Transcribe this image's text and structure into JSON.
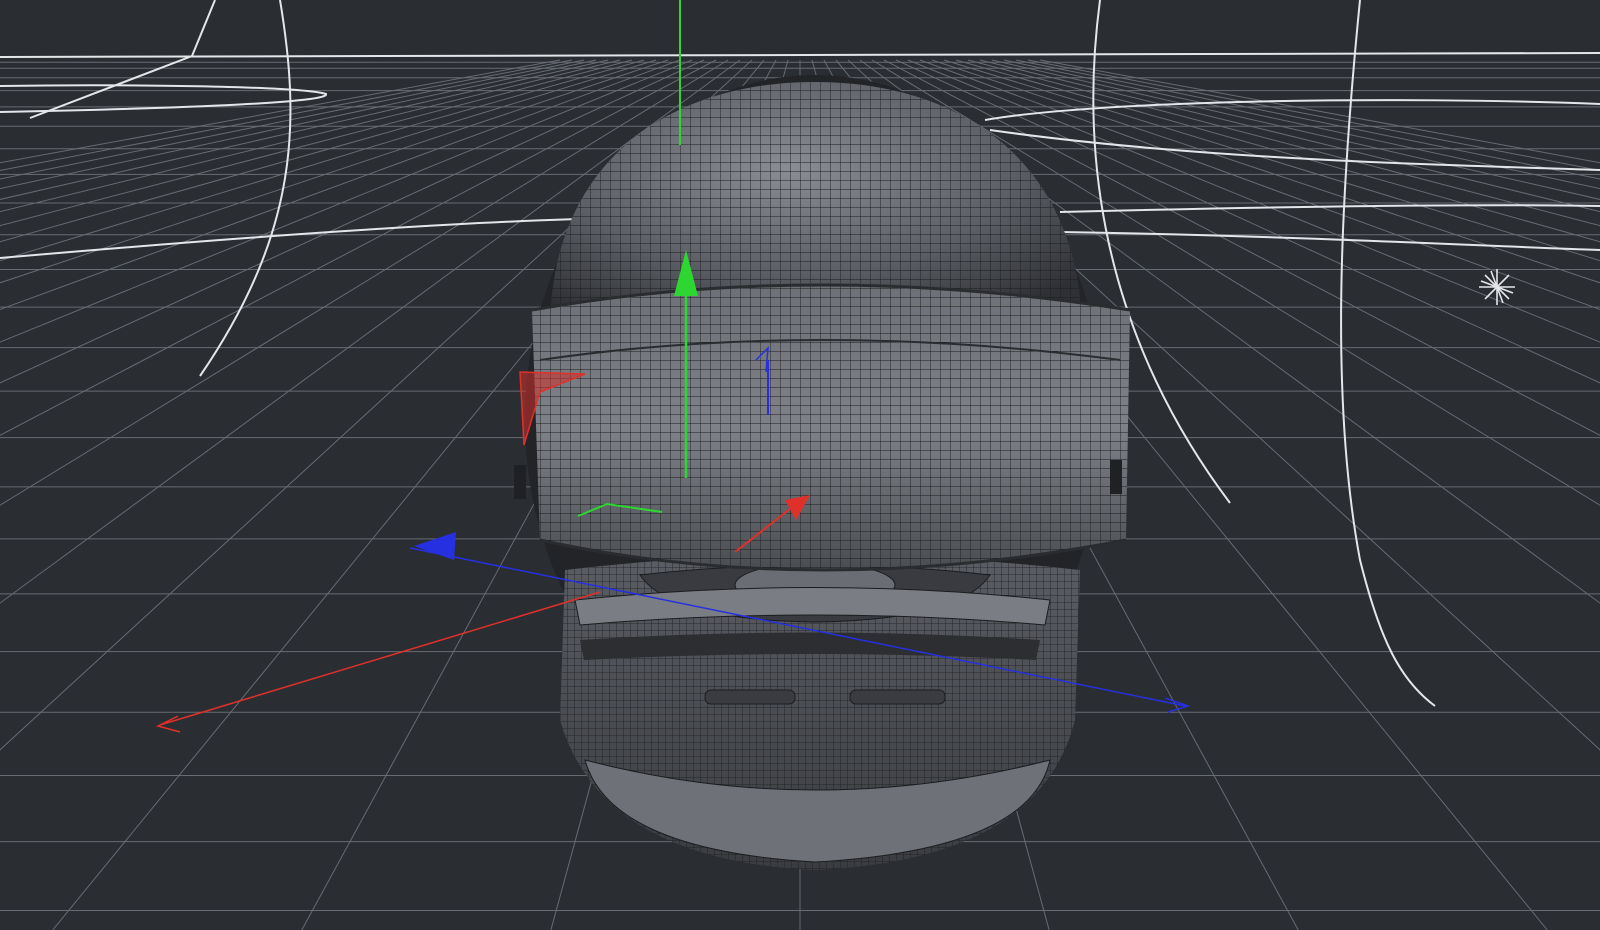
{
  "viewport": {
    "background": "#2a2d32",
    "grid_color": "#7c8088",
    "curve_color": "#e4e6ea"
  },
  "model": {
    "object": "helmet-mesh",
    "display_mode": "wireframe-on-shaded",
    "shell_color": "#55585e",
    "wire_color": "#1b1c1f"
  },
  "gizmo": {
    "colors": {
      "x": "#e0302a",
      "y": "#2ed632",
      "z": "#2630e0"
    }
  },
  "icons": {
    "light": "light-star-icon"
  }
}
